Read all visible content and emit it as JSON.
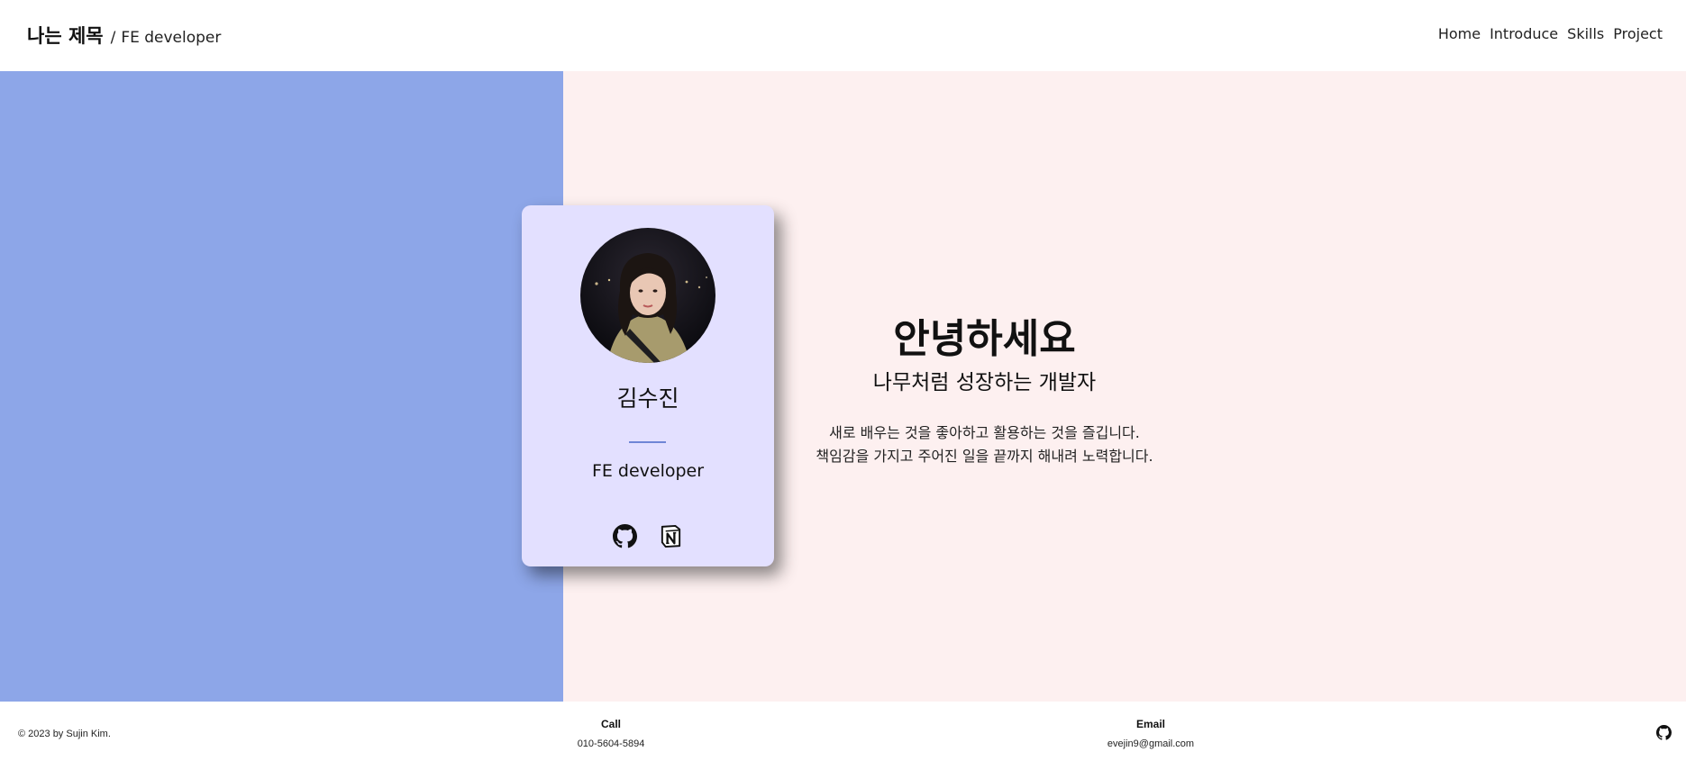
{
  "header": {
    "title": "나는 제목",
    "separator": "/",
    "subtitle": "FE developer",
    "nav": [
      "Home",
      "Introduce",
      "Skills",
      "Project"
    ]
  },
  "colors": {
    "left_panel": "#8da6e8",
    "right_panel": "#fdf0f0",
    "card_bg": "#e3e0ff",
    "divider": "#6f86d6"
  },
  "card": {
    "name": "김수진",
    "role": "FE developer",
    "icons": [
      "github-icon",
      "notion-icon"
    ]
  },
  "intro": {
    "title": "안녕하세요",
    "subtitle": "나무처럼 성장하는 개발자",
    "line1": "새로 배우는 것을 좋아하고 활용하는 것을 즐깁니다.",
    "line2": "책임감을 가지고 주어진 일을 끝까지 해내려 노력합니다."
  },
  "footer": {
    "copyright": "© 2023 by Sujin Kim.",
    "call_label": "Call",
    "call_value": "010-5604-5894",
    "email_label": "Email",
    "email_value": "evejin9@gmail.com",
    "icon": "github-icon"
  }
}
